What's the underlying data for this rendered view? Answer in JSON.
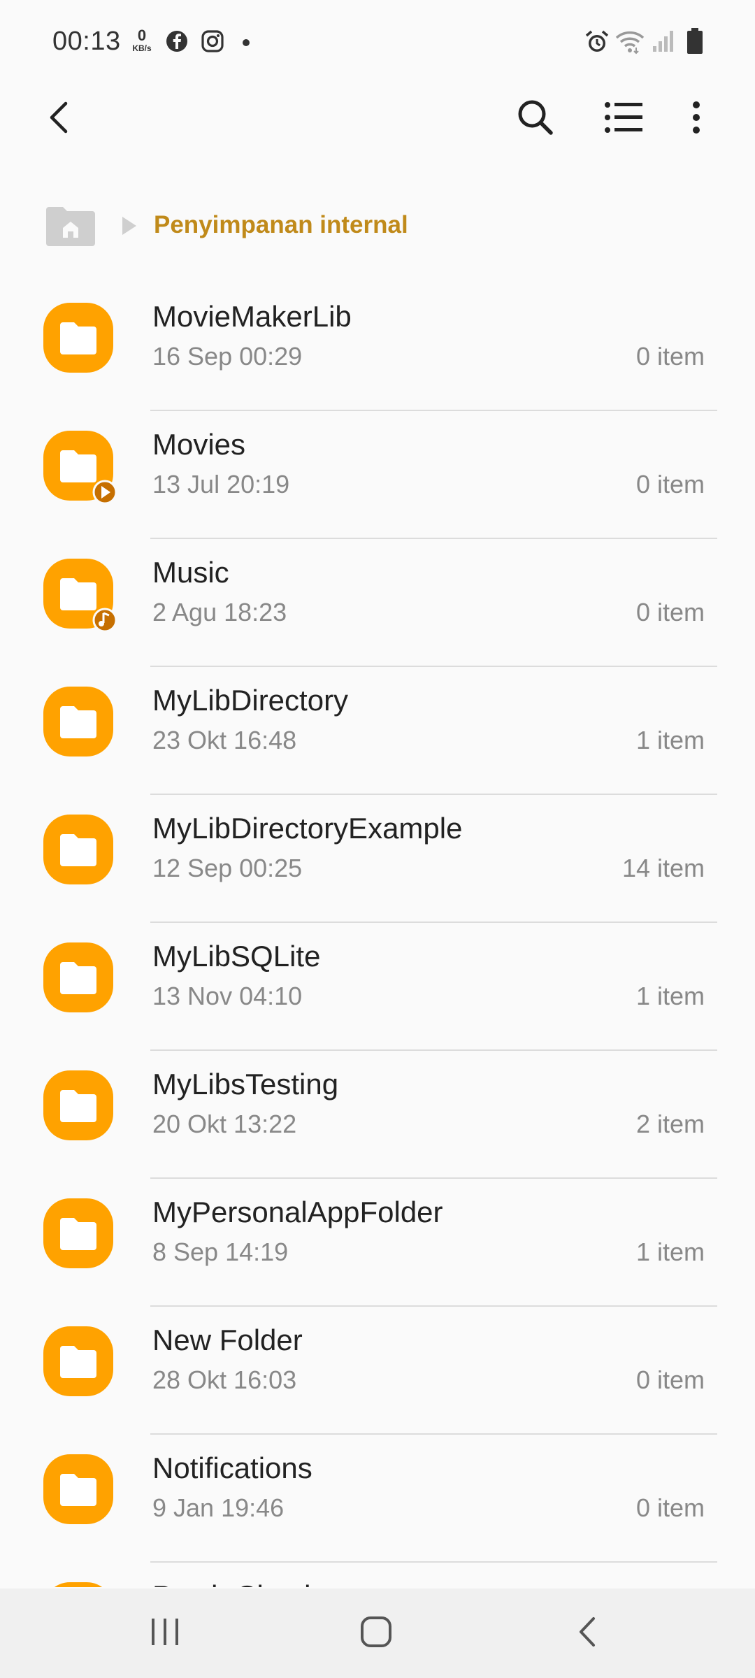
{
  "status_bar": {
    "time": "00:13",
    "net_speed_value": "0",
    "net_speed_unit": "KB/s",
    "icons": [
      "facebook-icon",
      "instagram-icon",
      "dot-icon",
      "alarm-icon",
      "wifi-icon",
      "signal-icon",
      "battery-icon"
    ]
  },
  "toolbar": {
    "icons": [
      "back-arrow-icon",
      "search-icon",
      "list-view-icon",
      "more-options-icon"
    ]
  },
  "breadcrumb": {
    "home_icon": "home-folder-icon",
    "separator_icon": "breadcrumb-arrow-icon",
    "current": "Penyimpanan internal"
  },
  "colors": {
    "folder": "#ffa200",
    "folder_badge": "#c66f00",
    "breadcrumb_accent": "#c08a1a",
    "background": "#fafafa"
  },
  "files": [
    {
      "name": "MovieMakerLib",
      "date": "16 Sep 00:29",
      "count": "0 item",
      "badge": ""
    },
    {
      "name": "Movies",
      "date": "13 Jul 20:19",
      "count": "0 item",
      "badge": "play"
    },
    {
      "name": "Music",
      "date": "2 Agu 18:23",
      "count": "0 item",
      "badge": "music"
    },
    {
      "name": "MyLibDirectory",
      "date": "23 Okt 16:48",
      "count": "1 item",
      "badge": ""
    },
    {
      "name": "MyLibDirectoryExample",
      "date": "12 Sep 00:25",
      "count": "14 item",
      "badge": ""
    },
    {
      "name": "MyLibSQLite",
      "date": "13 Nov 04:10",
      "count": "1 item",
      "badge": ""
    },
    {
      "name": "MyLibsTesting",
      "date": "20 Okt 13:22",
      "count": "2 item",
      "badge": ""
    },
    {
      "name": "MyPersonalAppFolder",
      "date": "8 Sep 14:19",
      "count": "1 item",
      "badge": ""
    },
    {
      "name": "New Folder",
      "date": "28 Okt 16:03",
      "count": "0 item",
      "badge": ""
    },
    {
      "name": "Notifications",
      "date": "9 Jan 19:46",
      "count": "0 item",
      "badge": ""
    },
    {
      "name": "Patch Check",
      "date": "",
      "count": "",
      "badge": ""
    }
  ],
  "nav_bar": {
    "icons": [
      "recent-apps-icon",
      "home-icon",
      "nav-back-icon"
    ]
  }
}
